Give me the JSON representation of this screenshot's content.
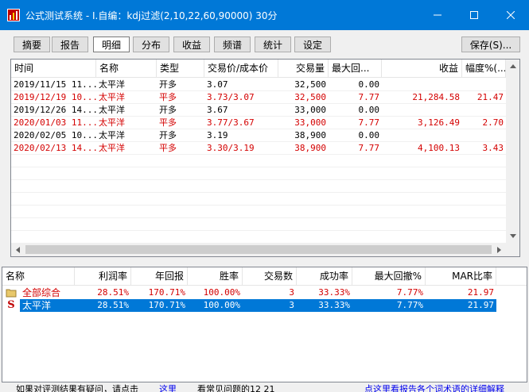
{
  "window": {
    "title": "公式测试系统 - I.自编：kdj过滤(2,10,22,60,90000) 30分",
    "icon": "chart-app-icon",
    "accent": "#0078d7"
  },
  "tabs": [
    {
      "label": "摘要"
    },
    {
      "label": "报告"
    },
    {
      "label": "明细",
      "active": true
    },
    {
      "label": "分布"
    },
    {
      "label": "收益"
    },
    {
      "label": "频谱"
    },
    {
      "label": "统计"
    },
    {
      "label": "设定"
    }
  ],
  "save_button": "保存(S)...",
  "trades": {
    "headers": [
      "时间",
      "名称",
      "类型",
      "交易价/成本价",
      "交易量",
      "最大回...",
      "收益",
      "幅度%(..."
    ],
    "rows": [
      {
        "time": "2019/11/15 11...",
        "name": "太平洋",
        "type": "开多",
        "price": "3.07",
        "volume": "32,500",
        "drawdown": "0.00",
        "profit": "",
        "pct": "",
        "color": "black"
      },
      {
        "time": "2019/12/19 10...",
        "name": "太平洋",
        "type": "平多",
        "price": "3.73/3.07",
        "volume": "32,500",
        "drawdown": "7.77",
        "profit": "21,284.58",
        "pct": "21.47",
        "color": "red"
      },
      {
        "time": "2019/12/26 14...",
        "name": "太平洋",
        "type": "开多",
        "price": "3.67",
        "volume": "33,000",
        "drawdown": "0.00",
        "profit": "",
        "pct": "",
        "color": "black"
      },
      {
        "time": "2020/01/03 11...",
        "name": "太平洋",
        "type": "平多",
        "price": "3.77/3.67",
        "volume": "33,000",
        "drawdown": "7.77",
        "profit": "3,126.49",
        "pct": "2.70",
        "color": "red"
      },
      {
        "time": "2020/02/05 10...",
        "name": "太平洋",
        "type": "开多",
        "price": "3.19",
        "volume": "38,900",
        "drawdown": "0.00",
        "profit": "",
        "pct": "",
        "color": "black"
      },
      {
        "time": "2020/02/13 14...",
        "name": "太平洋",
        "type": "平多",
        "price": "3.30/3.19",
        "volume": "38,900",
        "drawdown": "7.77",
        "profit": "4,100.13",
        "pct": "3.43",
        "color": "red"
      }
    ]
  },
  "summary": {
    "headers": [
      "名称",
      "利润率",
      "年回报",
      "胜率",
      "交易数",
      "成功率",
      "最大回撤%",
      "MAR比率"
    ],
    "rows": [
      {
        "icon": "folder-icon",
        "name": "全部综合",
        "profit_rate": "28.51%",
        "annual": "170.71%",
        "win": "100.00%",
        "trades": "3",
        "success": "33.33%",
        "maxdd": "7.77%",
        "mar": "21.97",
        "selected": false
      },
      {
        "icon": "stock-s-icon",
        "icon_text": "S",
        "name": "太平洋",
        "profit_rate": "28.51%",
        "annual": "170.71%",
        "win": "100.00%",
        "trades": "3",
        "success": "33.33%",
        "maxdd": "7.77%",
        "mar": "21.97",
        "selected": true
      }
    ]
  },
  "status": {
    "left": "如果对评测结果有疑问，请点击",
    "link1": "这里",
    "mid": "看常见问题的12 21",
    "right": "点这里看报告各个词术语的详细解释"
  }
}
